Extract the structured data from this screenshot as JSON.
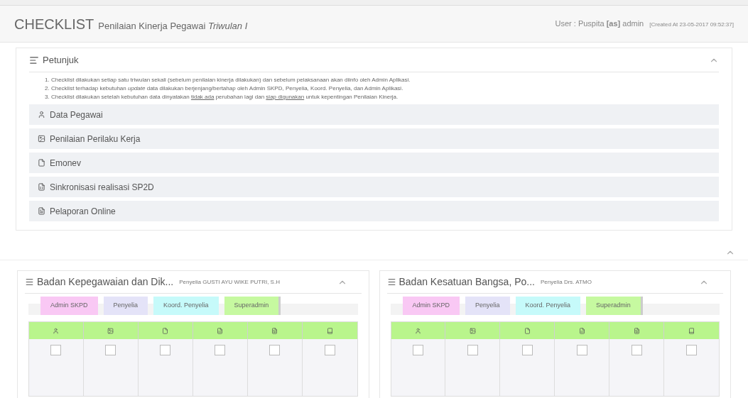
{
  "header": {
    "title": "CHECKLIST",
    "subtitle": "Penilaian Kinerja Pegawai *Triwulan I*",
    "user": "User : Puspita **[as]** admin",
    "created": "[Created At 23-05-2017 09:52:37]"
  },
  "guide": {
    "title": "Petunjuk",
    "expanded": true,
    "instructions": [
      {
        "number": "1.",
        "parts": [
          {
            "text": "Checklist dilakukan setiap satu triwulan sekali (sebelum penilaian kinerja dilakukan) dan sebelum pelaksanaan akan diinfo oleh Admin Aplikasi.",
            "kind": "plain"
          }
        ]
      },
      {
        "number": "2.",
        "parts": [
          {
            "text": "Checklist terhadap kebutuhan ",
            "kind": "plain"
          },
          {
            "text": "update",
            "kind": "italic"
          },
          {
            "text": " data dilakukan berjenjang/bertahap oleh Admin SKPD, Penyelia, Koord. Penyelia, dan Admin Aplikasi.",
            "kind": "plain"
          }
        ]
      },
      {
        "number": "3.",
        "parts": [
          {
            "text": "Checklist dilakukan setelah kebutuhan data dinyatakan ",
            "kind": "plain"
          },
          {
            "text": "tidak ada",
            "kind": "underline"
          },
          {
            "text": " perubahan lagi dan ",
            "kind": "plain"
          },
          {
            "text": "siap digunakan",
            "kind": "underline"
          },
          {
            "text": " untuk kepentingan Penilaian Kinerja.",
            "kind": "plain"
          }
        ]
      }
    ],
    "items": [
      {
        "kind": "person",
        "label": "Data Pegawai"
      },
      {
        "kind": "image",
        "label": "Penilaian Perilaku Kerja"
      },
      {
        "kind": "file",
        "label": "Emonev"
      },
      {
        "kind": "excel",
        "label": "Sinkronisasi realisasi SP2D"
      },
      {
        "kind": "word",
        "label": "Pelaporan Online"
      }
    ]
  },
  "section": {
    "expanded": true
  },
  "cards": [
    {
      "title": "Badan Kepegawaian dan Dik...",
      "supervisor": "Penyelia GUSTI AYU WIKE PUTRI, S.H",
      "expanded": true,
      "tabs": [
        {
          "label": "Admin SKPD",
          "color": "#f9c8f4"
        },
        {
          "label": "Penyelia",
          "color": "#e4e3f8"
        },
        {
          "label": "Koord. Penyelia",
          "color": "#c6fafa"
        },
        {
          "label": "Superadmin",
          "color": "#c6f9a0"
        }
      ],
      "columns": [
        {
          "kind": "person"
        },
        {
          "kind": "image"
        },
        {
          "kind": "file"
        },
        {
          "kind": "excel"
        },
        {
          "kind": "word"
        },
        {
          "kind": "book"
        }
      ],
      "cells": [
        {
          "checked": false
        },
        {
          "checked": false
        },
        {
          "checked": false
        },
        {
          "checked": false
        },
        {
          "checked": false
        },
        {
          "checked": false
        }
      ]
    },
    {
      "title": "Badan Kesatuan Bangsa, Po...",
      "supervisor": "Penyelia Drs. ATMO",
      "expanded": true,
      "tabs": [
        {
          "label": "Admin SKPD",
          "color": "#f9c8f4"
        },
        {
          "label": "Penyelia",
          "color": "#e4e3f8"
        },
        {
          "label": "Koord. Penyelia",
          "color": "#c6fafa"
        },
        {
          "label": "Superadmin",
          "color": "#c6f9a0"
        }
      ],
      "columns": [
        {
          "kind": "person"
        },
        {
          "kind": "image"
        },
        {
          "kind": "file"
        },
        {
          "kind": "excel"
        },
        {
          "kind": "word"
        },
        {
          "kind": "book"
        }
      ],
      "cells": [
        {
          "checked": false
        },
        {
          "checked": false
        },
        {
          "checked": false
        },
        {
          "checked": false
        },
        {
          "checked": false
        },
        {
          "checked": false
        }
      ]
    }
  ]
}
